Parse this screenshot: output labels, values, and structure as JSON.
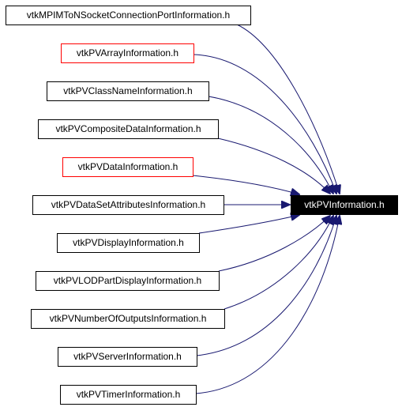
{
  "target": {
    "label": "vtkPVInformation.h"
  },
  "colors": {
    "edge": "#191970",
    "red_border": "#ff0000",
    "default_border": "#000000",
    "target_fill": "#000000"
  },
  "nodes": [
    {
      "label": "vtkMPIMToNSocketConnectionPortInformation.h",
      "border": "black"
    },
    {
      "label": "vtkPVArrayInformation.h",
      "border": "red"
    },
    {
      "label": "vtkPVClassNameInformation.h",
      "border": "black"
    },
    {
      "label": "vtkPVCompositeDataInformation.h",
      "border": "black"
    },
    {
      "label": "vtkPVDataInformation.h",
      "border": "red"
    },
    {
      "label": "vtkPVDataSetAttributesInformation.h",
      "border": "black"
    },
    {
      "label": "vtkPVDisplayInformation.h",
      "border": "black"
    },
    {
      "label": "vtkPVLODPartDisplayInformation.h",
      "border": "black"
    },
    {
      "label": "vtkPVNumberOfOutputsInformation.h",
      "border": "black"
    },
    {
      "label": "vtkPVServerInformation.h",
      "border": "black"
    },
    {
      "label": "vtkPVTimerInformation.h",
      "border": "black"
    }
  ]
}
